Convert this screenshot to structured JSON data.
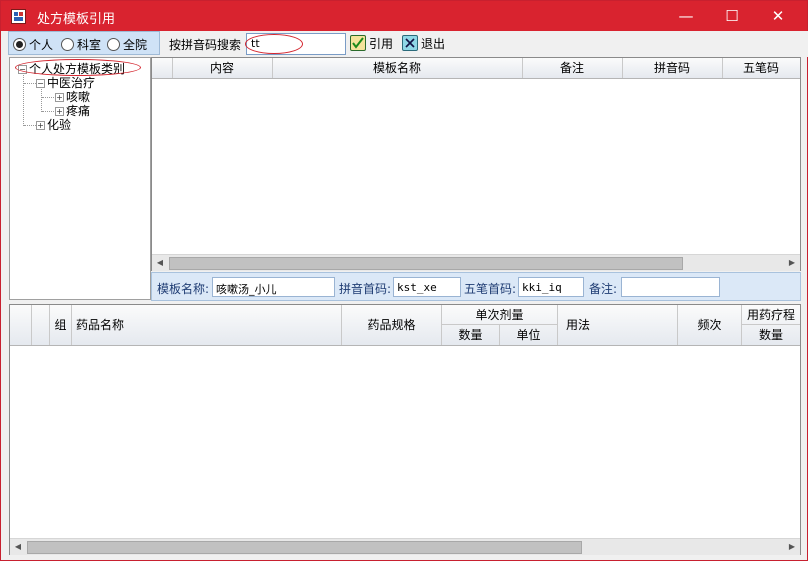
{
  "window": {
    "title": "处方模板引用",
    "min": "—",
    "max": "☐",
    "close": "✕"
  },
  "scope": {
    "options": [
      {
        "label": "个人",
        "selected": true
      },
      {
        "label": "科室",
        "selected": false
      },
      {
        "label": "全院",
        "selected": false
      }
    ]
  },
  "search": {
    "label": "按拼音码搜索",
    "value": "tt"
  },
  "toolbar": {
    "apply_label": "引用",
    "exit_label": "退出"
  },
  "tree": {
    "root": "个人处方模板类别",
    "nodes": [
      {
        "label": "中医治疗"
      },
      {
        "label": "咳嗽"
      },
      {
        "label": "疼痛"
      },
      {
        "label": "化验"
      }
    ]
  },
  "grid_top": {
    "columns": [
      "内容",
      "模板名称",
      "备注",
      "拼音码",
      "五笔码"
    ],
    "rows": []
  },
  "info": {
    "name_label": "模板名称:",
    "name_value": "咳嗽汤_小儿",
    "py_label": "拼音首码:",
    "py_value": "kst_xe",
    "wb_label": "五笔首码:",
    "wb_value": "kki_iq",
    "note_label": "备注:",
    "note_value": ""
  },
  "grid_bottom": {
    "columns": {
      "group": "组",
      "drug_name": "药品名称",
      "spec": "药品规格",
      "dose": "单次剂量",
      "qty": "数量",
      "unit": "单位",
      "usage": "用法",
      "freq": "频次",
      "course": "用药疗程",
      "course_qty": "数量"
    },
    "rows": []
  },
  "colors": {
    "titlebar": "#d9232f",
    "accent": "#cfe2f6",
    "annotation": "#d4262f"
  }
}
